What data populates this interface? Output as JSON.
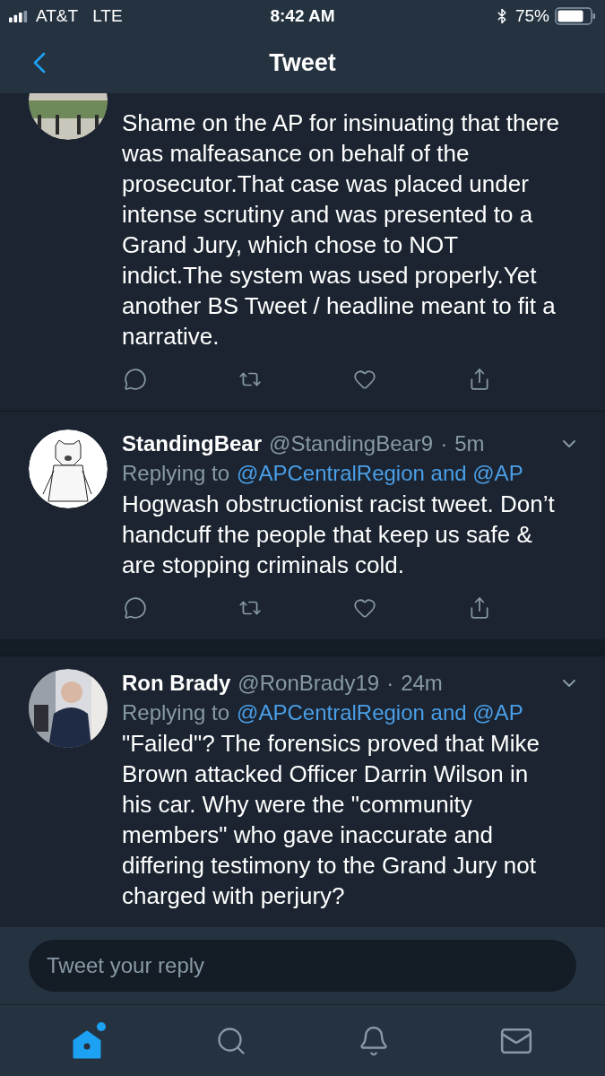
{
  "status_bar": {
    "carrier": "AT&T",
    "network": "LTE",
    "time": "8:42 AM",
    "battery": "75%"
  },
  "header": {
    "title": "Tweet"
  },
  "tweets": [
    {
      "text": "Shame on the AP for insinuating that there was malfeasance on behalf of the prosecutor.That case was placed under intense scrutiny and was presented to a Grand Jury, which chose to NOT indict.The system was used properly.Yet another BS Tweet / headline meant to fit a narrative.",
      "show_actions": true,
      "show_menu": false
    },
    {
      "name": "StandingBear",
      "handle": "@StandingBear9",
      "separator": "·",
      "time": "5m",
      "replying_prefix": "Replying to",
      "replying_to": "@APCentralRegion and @AP",
      "text": "Hogwash obstructionist racist tweet. Don’t handcuff the people that keep us safe & are stopping criminals cold.",
      "show_actions": true,
      "show_menu": true
    },
    {
      "name": "Ron Brady",
      "handle": "@RonBrady19",
      "separator": "·",
      "time": "24m",
      "replying_prefix": "Replying to",
      "replying_to": "@APCentralRegion and @AP",
      "text": "\"Failed\"? The forensics proved that Mike Brown attacked Officer Darrin Wilson in his car. Why were the \"community members\" who gave inaccurate and differing testimony to the Grand Jury not charged with perjury?",
      "show_actions": false,
      "show_menu": true
    }
  ],
  "composer": {
    "placeholder": "Tweet your reply"
  },
  "tab_bar": [
    {
      "kind": "home",
      "selected": true
    },
    {
      "kind": "search",
      "selected": false
    },
    {
      "kind": "notifications",
      "selected": false
    },
    {
      "kind": "messages",
      "selected": false
    }
  ]
}
